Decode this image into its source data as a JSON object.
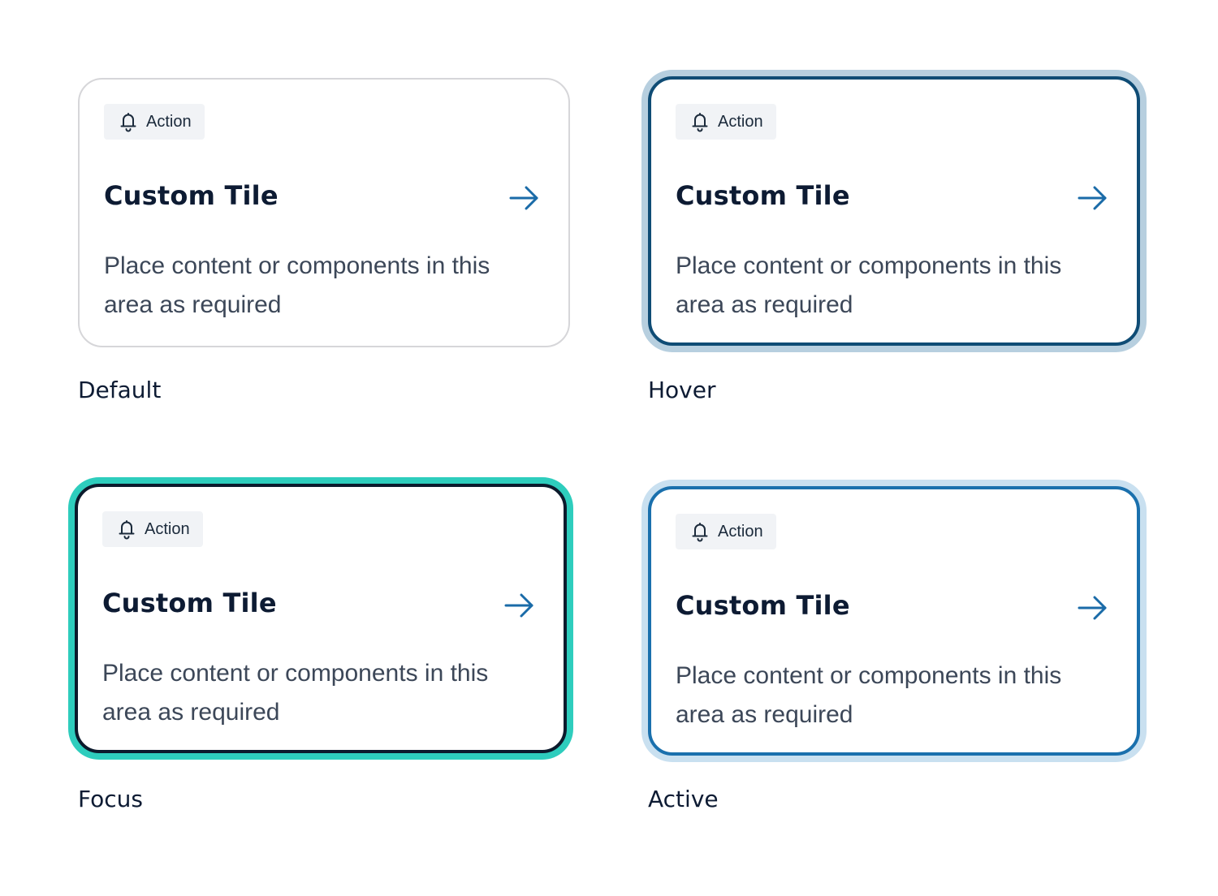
{
  "colors": {
    "default_border": "#d6d6d9",
    "hover_border": "#0f4c75",
    "hover_ring": "#b7cfdf",
    "focus_border": "#0c1a2c",
    "focus_ring": "#2ecdbd",
    "active_border": "#1a70ad",
    "active_ring": "#c9e0f0",
    "arrow": "#1a6ba8",
    "chip_bg": "#f1f3f6"
  },
  "tiles": [
    {
      "state": "Default",
      "chip_icon": "bell-icon",
      "chip_label": "Action",
      "title": "Custom Tile",
      "arrow_icon": "arrow-right-icon",
      "description": "Place content or components in this area as required"
    },
    {
      "state": "Hover",
      "chip_icon": "bell-icon",
      "chip_label": "Action",
      "title": "Custom Tile",
      "arrow_icon": "arrow-right-icon",
      "description": "Place content or components in this area as required"
    },
    {
      "state": "Focus",
      "chip_icon": "bell-icon",
      "chip_label": "Action",
      "title": "Custom Tile",
      "arrow_icon": "arrow-right-icon",
      "description": "Place content or components in this area as required"
    },
    {
      "state": "Active",
      "chip_icon": "bell-icon",
      "chip_label": "Action",
      "title": "Custom Tile",
      "arrow_icon": "arrow-right-icon",
      "description": "Place content or components in this area as required"
    }
  ]
}
